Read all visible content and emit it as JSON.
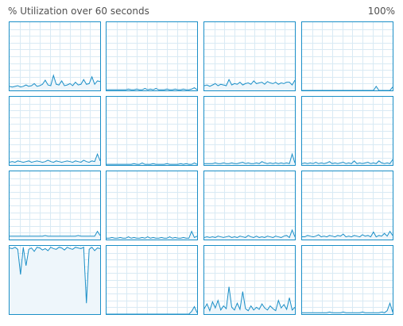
{
  "header": {
    "title": "% Utilization over 60 seconds",
    "max_label": "100%"
  },
  "colors": {
    "accent": "#1b8fc7",
    "grid": "#d9eaf4",
    "fill": "#eef6fb",
    "text": "#505050"
  },
  "graph": {
    "duration_seconds": 60,
    "y_min": 0,
    "y_max": 100
  },
  "cores": [
    {
      "utilization": [
        6,
        5,
        6,
        7,
        5,
        6,
        8,
        6,
        7,
        10,
        6,
        7,
        9,
        15,
        8,
        7,
        22,
        9,
        8,
        14,
        7,
        8,
        10,
        7,
        12,
        8,
        9,
        16,
        9,
        10,
        20,
        9,
        14,
        13
      ]
    },
    {
      "utilization": [
        1,
        1,
        1,
        1,
        1,
        1,
        1,
        1,
        2,
        1,
        1,
        2,
        1,
        1,
        3,
        1,
        2,
        1,
        3,
        1,
        1,
        1,
        2,
        1,
        1,
        2,
        1,
        1,
        2,
        1,
        1,
        2,
        4,
        1
      ]
    },
    {
      "utilization": [
        7,
        8,
        6,
        8,
        10,
        7,
        9,
        8,
        7,
        16,
        8,
        10,
        9,
        12,
        8,
        10,
        11,
        9,
        14,
        10,
        11,
        12,
        9,
        13,
        11,
        10,
        12,
        9,
        11,
        10,
        12,
        12,
        8,
        15
      ]
    },
    {
      "utilization": [
        0,
        0,
        0,
        0,
        0,
        0,
        0,
        0,
        0,
        0,
        0,
        0,
        0,
        0,
        0,
        0,
        0,
        0,
        0,
        0,
        0,
        0,
        0,
        0,
        0,
        0,
        0,
        6,
        0,
        0,
        0,
        0,
        0,
        5
      ]
    },
    {
      "utilization": [
        4,
        5,
        4,
        6,
        5,
        4,
        5,
        6,
        4,
        5,
        6,
        5,
        4,
        5,
        7,
        5,
        4,
        6,
        5,
        4,
        5,
        6,
        5,
        4,
        6,
        5,
        4,
        7,
        5,
        4,
        6,
        5,
        16,
        6
      ]
    },
    {
      "utilization": [
        1,
        1,
        1,
        1,
        1,
        1,
        1,
        1,
        1,
        1,
        2,
        1,
        1,
        3,
        1,
        1,
        1,
        2,
        1,
        1,
        1,
        1,
        2,
        1,
        1,
        1,
        1,
        2,
        1,
        2,
        1,
        1,
        3,
        1
      ]
    },
    {
      "utilization": [
        2,
        2,
        2,
        2,
        3,
        2,
        2,
        3,
        2,
        2,
        3,
        2,
        2,
        3,
        4,
        2,
        3,
        2,
        2,
        3,
        2,
        5,
        3,
        2,
        3,
        2,
        3,
        2,
        3,
        2,
        3,
        2,
        16,
        3
      ]
    },
    {
      "utilization": [
        2,
        3,
        2,
        3,
        2,
        4,
        2,
        3,
        2,
        3,
        5,
        2,
        3,
        2,
        3,
        4,
        2,
        3,
        2,
        6,
        2,
        3,
        2,
        3,
        4,
        2,
        3,
        2,
        6,
        3,
        2,
        3,
        2,
        8
      ]
    },
    {
      "utilization": [
        5,
        5,
        5,
        5,
        5,
        5,
        5,
        5,
        5,
        5,
        5,
        5,
        5,
        6,
        5,
        5,
        5,
        5,
        5,
        5,
        5,
        5,
        5,
        5,
        5,
        6,
        5,
        5,
        5,
        5,
        5,
        5,
        12,
        6
      ]
    },
    {
      "utilization": [
        2,
        2,
        3,
        2,
        2,
        3,
        2,
        2,
        4,
        2,
        3,
        2,
        2,
        3,
        2,
        4,
        2,
        3,
        2,
        2,
        3,
        2,
        2,
        4,
        2,
        3,
        2,
        2,
        3,
        2,
        2,
        12,
        3,
        5
      ]
    },
    {
      "utilization": [
        3,
        4,
        3,
        4,
        3,
        5,
        4,
        3,
        4,
        5,
        3,
        4,
        3,
        5,
        4,
        3,
        6,
        4,
        3,
        5,
        3,
        4,
        3,
        5,
        4,
        3,
        5,
        4,
        3,
        5,
        6,
        3,
        14,
        4
      ]
    },
    {
      "utilization": [
        4,
        4,
        6,
        5,
        4,
        5,
        7,
        4,
        5,
        4,
        6,
        5,
        4,
        6,
        5,
        8,
        4,
        5,
        4,
        6,
        5,
        4,
        7,
        5,
        6,
        4,
        11,
        4,
        6,
        5,
        9,
        5,
        12,
        6
      ]
    },
    {
      "utilization": [
        97,
        96,
        98,
        95,
        58,
        98,
        71,
        95,
        97,
        92,
        98,
        97,
        94,
        96,
        93,
        98,
        96,
        95,
        98,
        97,
        94,
        98,
        96,
        95,
        98,
        97,
        96,
        98,
        16,
        95,
        98,
        93,
        97,
        96
      ]
    },
    {
      "utilization": [
        0,
        0,
        0,
        0,
        0,
        0,
        0,
        0,
        0,
        0,
        0,
        0,
        0,
        0,
        0,
        0,
        0,
        0,
        0,
        0,
        0,
        0,
        0,
        0,
        0,
        0,
        0,
        0,
        0,
        0,
        0,
        4,
        11,
        2
      ]
    },
    {
      "utilization": [
        8,
        15,
        5,
        18,
        9,
        20,
        6,
        12,
        8,
        40,
        10,
        6,
        16,
        7,
        33,
        8,
        5,
        12,
        6,
        10,
        7,
        15,
        9,
        6,
        12,
        8,
        5,
        20,
        9,
        14,
        7,
        24,
        6,
        10
      ]
    },
    {
      "utilization": [
        2,
        2,
        2,
        2,
        2,
        2,
        2,
        2,
        2,
        2,
        3,
        2,
        2,
        2,
        2,
        3,
        2,
        2,
        2,
        2,
        2,
        2,
        3,
        2,
        2,
        2,
        2,
        2,
        2,
        3,
        2,
        5,
        16,
        3
      ]
    }
  ]
}
